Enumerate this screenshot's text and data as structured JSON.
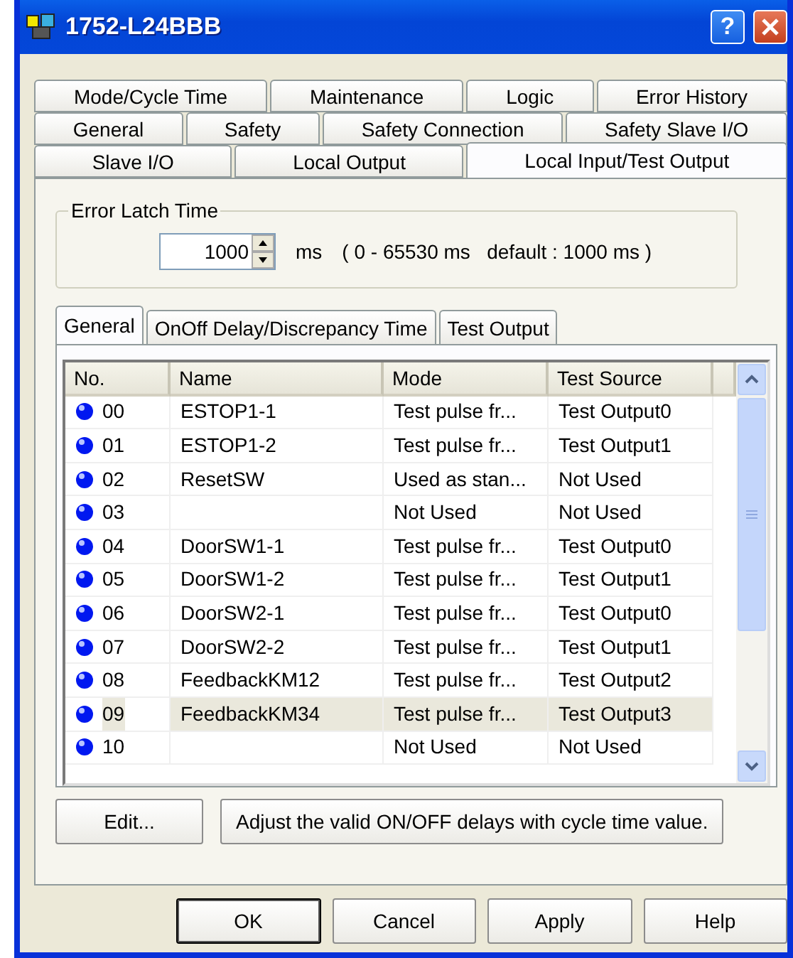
{
  "window": {
    "title": "1752-L24BBB",
    "help": "?"
  },
  "tab_rows": [
    [
      {
        "label": "Mode/Cycle Time",
        "selected": false
      },
      {
        "label": "Maintenance",
        "selected": false
      },
      {
        "label": "Logic",
        "selected": false
      },
      {
        "label": "Error History",
        "selected": false
      }
    ],
    [
      {
        "label": "General",
        "selected": false
      },
      {
        "label": "Safety",
        "selected": false
      },
      {
        "label": "Safety Connection",
        "selected": false
      },
      {
        "label": "Safety Slave I/O",
        "selected": false
      }
    ],
    [
      {
        "label": "Slave I/O",
        "selected": false
      },
      {
        "label": "Local Output",
        "selected": false
      },
      {
        "label": "Local Input/Test Output",
        "selected": true
      }
    ]
  ],
  "error_latch": {
    "title": "Error Latch Time",
    "value": "1000",
    "unit": "ms",
    "range": "( 0 - 65530 ms   default : 1000 ms )"
  },
  "sub_tabs": [
    {
      "label": "General",
      "selected": true
    },
    {
      "label": "OnOff Delay/Discrepancy Time",
      "selected": false
    },
    {
      "label": "Test Output",
      "selected": false
    }
  ],
  "table": {
    "columns": [
      "No.",
      "Name",
      "Mode",
      "Test Source"
    ],
    "rows": [
      {
        "no": "00",
        "name": "ESTOP1-1",
        "mode": "Test pulse fr...",
        "source": "Test Output0",
        "selected": false
      },
      {
        "no": "01",
        "name": "ESTOP1-2",
        "mode": "Test pulse fr...",
        "source": "Test Output1",
        "selected": false
      },
      {
        "no": "02",
        "name": "ResetSW",
        "mode": "Used as stan...",
        "source": "Not Used",
        "selected": false
      },
      {
        "no": "03",
        "name": "",
        "mode": "Not Used",
        "source": "Not Used",
        "selected": false
      },
      {
        "no": "04",
        "name": "DoorSW1-1",
        "mode": "Test pulse fr...",
        "source": "Test Output0",
        "selected": false
      },
      {
        "no": "05",
        "name": "DoorSW1-2",
        "mode": "Test pulse fr...",
        "source": "Test Output1",
        "selected": false
      },
      {
        "no": "06",
        "name": "DoorSW2-1",
        "mode": "Test pulse fr...",
        "source": "Test Output0",
        "selected": false
      },
      {
        "no": "07",
        "name": "DoorSW2-2",
        "mode": "Test pulse fr...",
        "source": "Test Output1",
        "selected": false
      },
      {
        "no": "08",
        "name": "FeedbackKM12",
        "mode": "Test pulse fr...",
        "source": "Test Output2",
        "selected": false
      },
      {
        "no": "09",
        "name": "FeedbackKM34",
        "mode": "Test pulse fr...",
        "source": "Test Output3",
        "selected": true
      },
      {
        "no": "10",
        "name": "",
        "mode": "Not Used",
        "source": "Not Used",
        "selected": false
      }
    ]
  },
  "panel_buttons": [
    "Edit...",
    "Adjust the valid ON/OFF delays with cycle time value."
  ],
  "buttons": [
    {
      "label": "OK",
      "default": true
    },
    {
      "label": "Cancel",
      "default": false
    },
    {
      "label": "Apply",
      "default": false
    },
    {
      "label": "Help",
      "default": false
    }
  ]
}
